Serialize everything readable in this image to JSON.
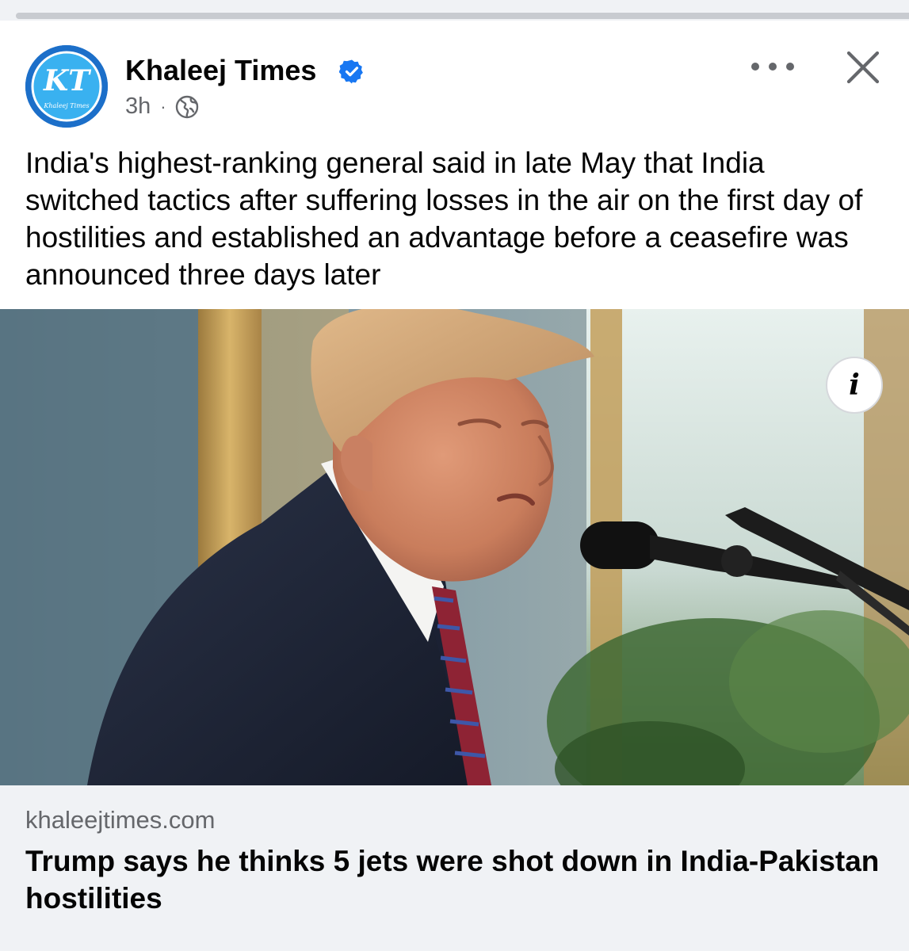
{
  "post": {
    "page_name": "Khaleej Times",
    "verified": true,
    "time": "3h",
    "separator": "·",
    "audience_icon": "globe-icon",
    "caption": "India's highest-ranking general said in late May that India switched tactics after suffering losses in the air on the first day of hostilities and established an advantage before a ceasefire was announced three days later",
    "avatar": {
      "monogram": "KT",
      "wordmark": "Khaleej Times",
      "color": "#1c6fc9"
    }
  },
  "link_preview": {
    "domain": "khaleejtimes.com",
    "headline": "Trump says he thinks 5 jets were shot down in India-Pakistan hostilities"
  },
  "icons": {
    "more": "more-options-icon",
    "close": "close-icon",
    "info": "info-icon",
    "info_glyph": "i",
    "verified": "verified-badge-icon"
  },
  "colors": {
    "primary_text": "#050505",
    "secondary_text": "#65676b",
    "verified_blue": "#1877f2",
    "card_background": "#f0f2f5"
  }
}
